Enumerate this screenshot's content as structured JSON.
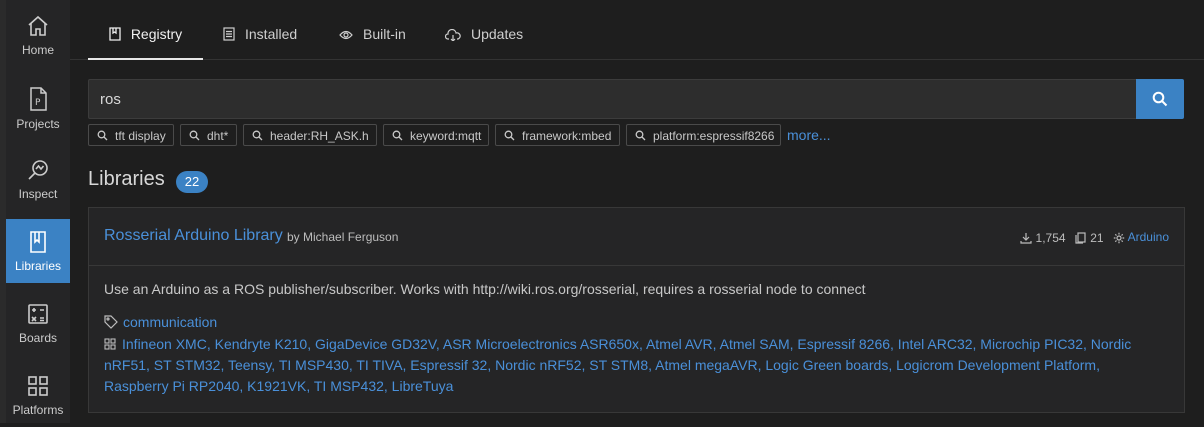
{
  "sidebar": {
    "items": [
      {
        "label": "Home",
        "icon": "home-icon"
      },
      {
        "label": "Projects",
        "icon": "project-file-icon"
      },
      {
        "label": "Inspect",
        "icon": "inspect-icon"
      },
      {
        "label": "Libraries",
        "icon": "book-icon",
        "active": true
      },
      {
        "label": "Boards",
        "icon": "calculator-icon"
      },
      {
        "label": "Platforms",
        "icon": "grid-icon"
      }
    ]
  },
  "tabs": [
    {
      "label": "Registry",
      "icon": "book-icon",
      "active": true
    },
    {
      "label": "Installed",
      "icon": "list-icon"
    },
    {
      "label": "Built-in",
      "icon": "eye-icon"
    },
    {
      "label": "Updates",
      "icon": "cloud-download-icon"
    }
  ],
  "search": {
    "value": "ros",
    "button_icon": "search-icon"
  },
  "chips": [
    "tft display",
    "dht*",
    "header:RH_ASK.h",
    "keyword:mqtt",
    "framework:mbed",
    "platform:espressif8266"
  ],
  "more_label": "more...",
  "libraries": {
    "heading": "Libraries",
    "count": "22"
  },
  "library": {
    "name": "Rosserial Arduino Library",
    "author": "by Michael Ferguson",
    "downloads": "1,754",
    "examples": "21",
    "framework": "Arduino",
    "description": "Use an Arduino as a ROS publisher/subscriber. Works with http://wiki.ros.org/rosserial, requires a rosserial node to connect",
    "keyword": "communication",
    "platforms": "Infineon XMC, Kendryte K210, GigaDevice GD32V, ASR Microelectronics ASR650x, Atmel AVR, Atmel SAM, Espressif 8266, Intel ARC32, Microchip PIC32, Nordic nRF51, ST STM32, Teensy, TI MSP430, TI TIVA, Espressif 32, Nordic nRF52, ST STM8, Atmel megaAVR, Logic Green boards, Logicrom Development Platform, Raspberry Pi RP2040, K1921VK, TI MSP432, LibreTuya"
  },
  "colors": {
    "accent": "#3b82c4",
    "link": "#4a90d9",
    "background": "#1e1e1e",
    "sidebar": "#252526"
  }
}
